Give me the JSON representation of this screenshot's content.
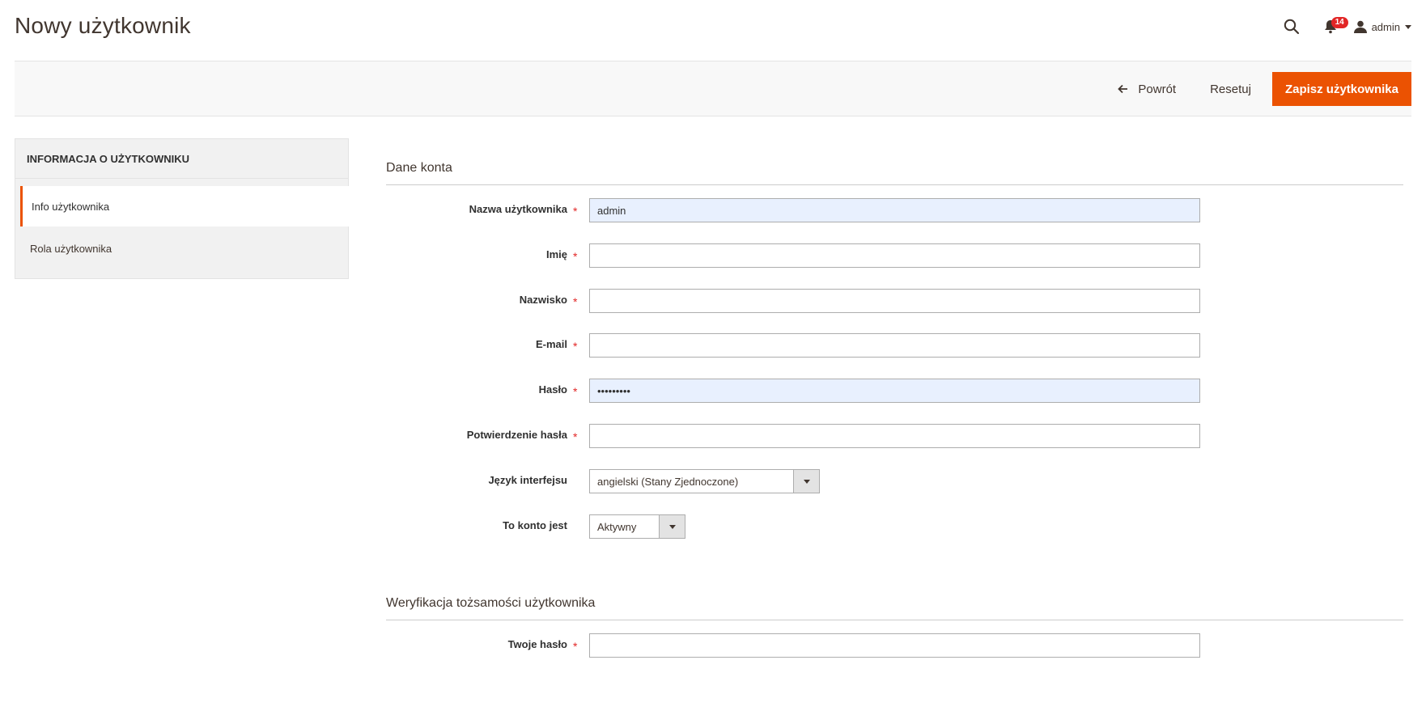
{
  "page": {
    "title": "Nowy użytkownik"
  },
  "header": {
    "notifications_count": "14",
    "user_name": "admin"
  },
  "action_bar": {
    "back_label": "Powrót",
    "reset_label": "Resetuj",
    "save_label": "Zapisz użytkownika"
  },
  "sidebar": {
    "title": "INFORMACJA O UŻYTKOWNIKU",
    "items": [
      {
        "label": "Info użytkownika",
        "active": true
      },
      {
        "label": "Rola użytkownika",
        "active": false
      }
    ]
  },
  "form": {
    "account_section": {
      "title": "Dane konta",
      "fields": {
        "username": {
          "label": "Nazwa użytkownika",
          "value": "admin"
        },
        "firstname": {
          "label": "Imię",
          "value": ""
        },
        "lastname": {
          "label": "Nazwisko",
          "value": ""
        },
        "email": {
          "label": "E-mail",
          "value": ""
        },
        "password": {
          "label": "Hasło",
          "value": "•••••••••"
        },
        "password_confirm": {
          "label": "Potwierdzenie hasła",
          "value": ""
        },
        "interface_locale": {
          "label": "Język interfejsu",
          "value": "angielski (Stany Zjednoczone)"
        },
        "is_active": {
          "label": "To konto jest",
          "value": "Aktywny"
        }
      }
    },
    "verification_section": {
      "title": "Weryfikacja tożsamości użytkownika",
      "fields": {
        "current_password": {
          "label": "Twoje hasło",
          "value": ""
        }
      }
    }
  },
  "colors": {
    "accent": "#eb5202",
    "required": "#e22626",
    "autofill_bg": "#e8f0fe"
  }
}
